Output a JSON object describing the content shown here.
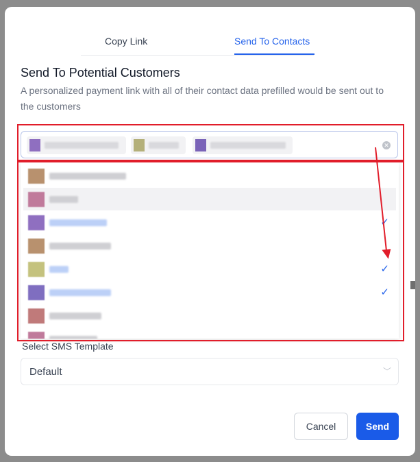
{
  "tabs": [
    {
      "label": "Copy Link",
      "active": false
    },
    {
      "label": "Send To Contacts",
      "active": true
    }
  ],
  "section": {
    "title": "Send To Potential Customers",
    "description": "A personalized payment link with all of their contact data prefilled would be sent out to the customers"
  },
  "contact_select": {
    "selected_tags": [
      {
        "avatar_color": "#8f6fc0"
      },
      {
        "avatar_color": "#b4b07a"
      },
      {
        "avatar_color": "#7a63b8"
      }
    ],
    "clear_icon": "clear-circle-icon"
  },
  "dropdown_options": [
    {
      "avatar_color": "#b8916e",
      "selected": false,
      "hover": false
    },
    {
      "avatar_color": "#c07a9b",
      "selected": false,
      "hover": true
    },
    {
      "avatar_color": "#8f6fc0",
      "selected": true,
      "hover": false
    },
    {
      "avatar_color": "#b8916e",
      "selected": false,
      "hover": false
    },
    {
      "avatar_color": "#c4c27e",
      "selected": true,
      "hover": false
    },
    {
      "avatar_color": "#7f6ec0",
      "selected": true,
      "hover": false
    },
    {
      "avatar_color": "#c07a7a",
      "selected": false,
      "hover": false
    },
    {
      "avatar_color": "#c07a9b",
      "selected": false,
      "hover": false
    }
  ],
  "sms": {
    "label": "Select SMS Template",
    "value": "Default"
  },
  "buttons": {
    "cancel": "Cancel",
    "send": "Send"
  },
  "colors": {
    "accent": "#2563eb",
    "send_button": "#1a5be8",
    "annotation_red": "#e11d2a"
  }
}
